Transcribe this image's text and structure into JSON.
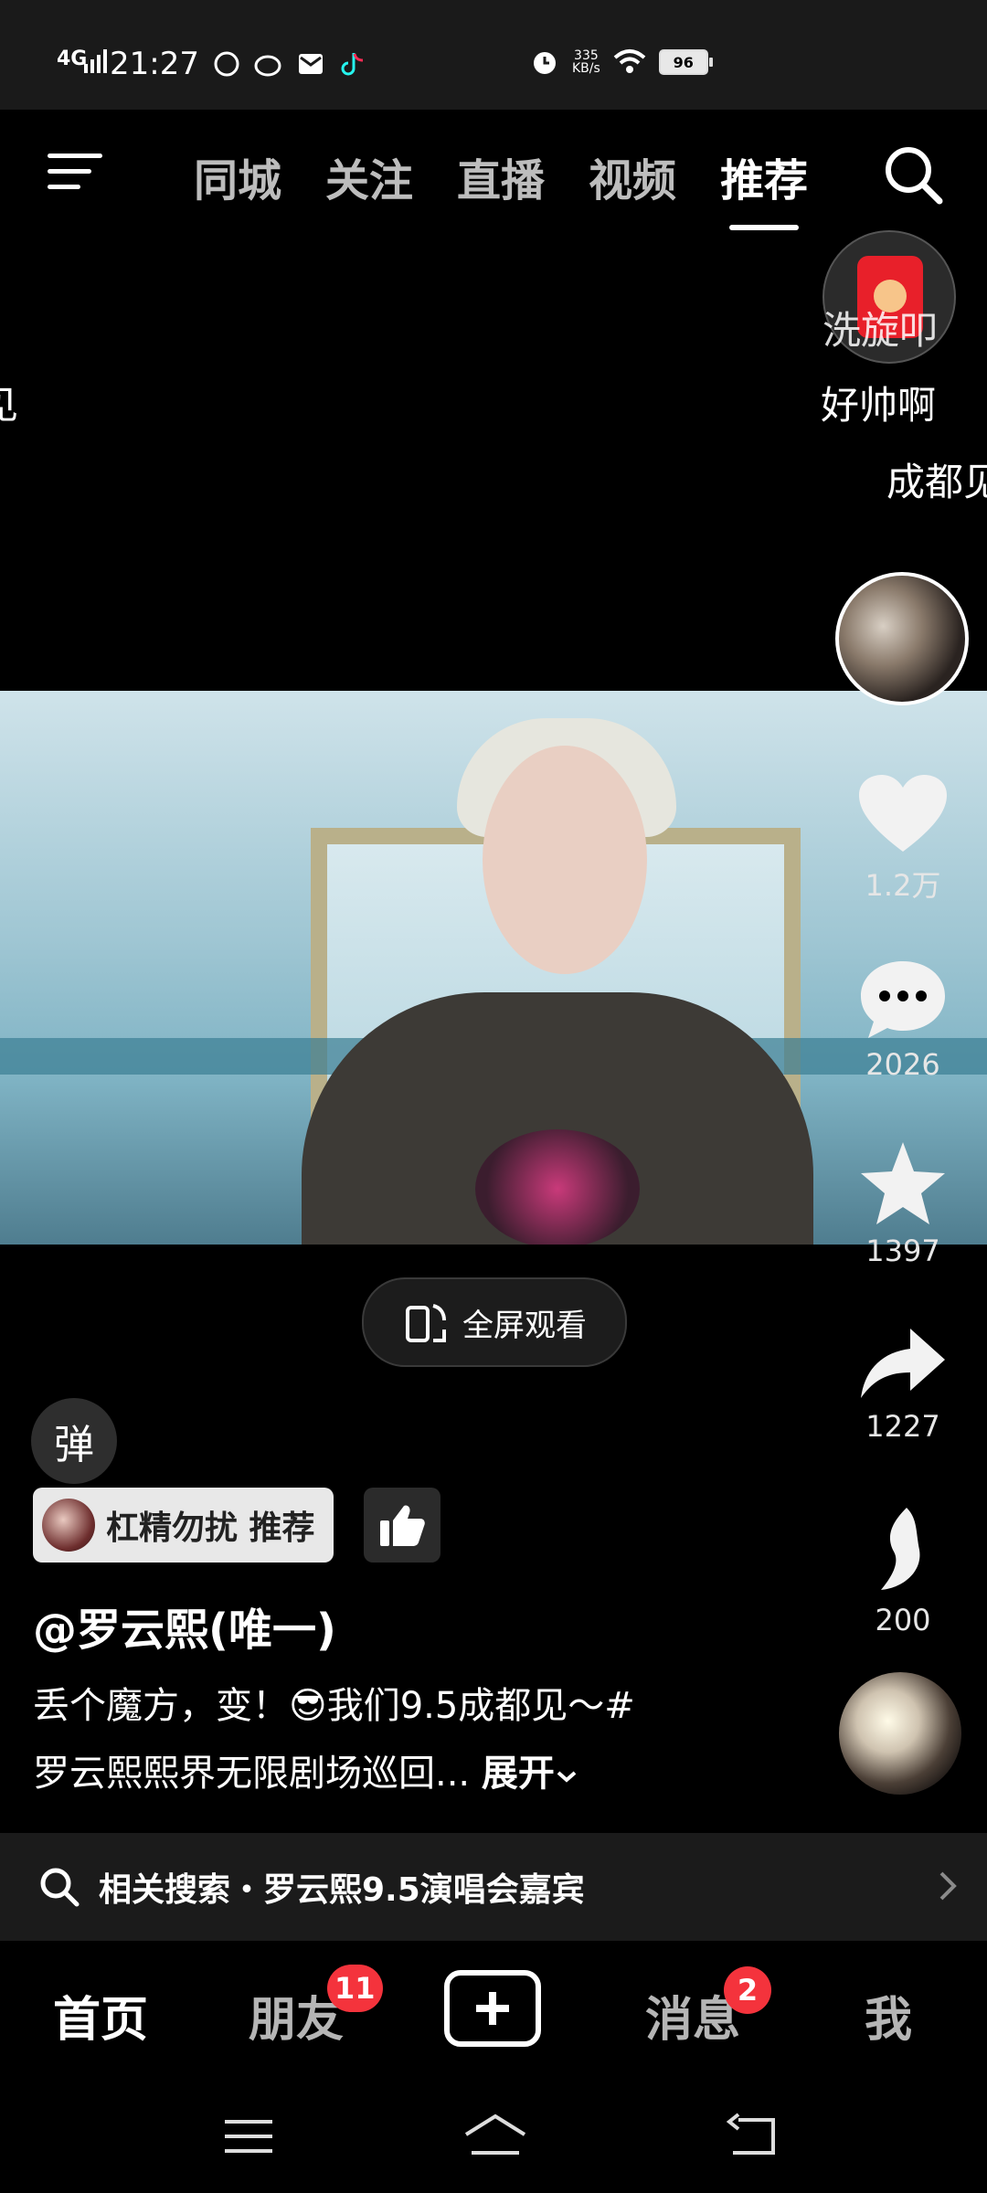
{
  "status_bar": {
    "network": "4G",
    "time": "21:27",
    "speed_value": "335",
    "speed_unit": "KB/s",
    "battery": "96"
  },
  "top_nav": {
    "tabs": [
      {
        "label": "同城"
      },
      {
        "label": "关注"
      },
      {
        "label": "直播"
      },
      {
        "label": "视频"
      },
      {
        "label": "推荐"
      }
    ],
    "active_tab": "推荐"
  },
  "danmaku": {
    "left_fragment": "见",
    "redpack_text": "洗旋叩",
    "line1": "好帅啊",
    "line2": "成都见"
  },
  "actions": {
    "like_count": "1.2万",
    "comment_count": "2026",
    "favorite_count": "1397",
    "share_count": "1227",
    "recommend_count": "200"
  },
  "fullscreen_label": "全屏观看",
  "danmu_toggle": "弹",
  "tag_chip": "杠精勿扰 推荐",
  "author": "@罗云熙(唯一)",
  "description": {
    "line1": "丢个魔方，变！😎我们9.5成都见～#",
    "line2": "罗云熙熙界无限剧场巡回...",
    "expand": "展开"
  },
  "related_search": {
    "text": "相关搜索・罗云熙9.5演唱会嘉宾"
  },
  "bottom_nav": {
    "home": "首页",
    "friends": "朋友",
    "friends_badge": "11",
    "messages": "消息",
    "messages_badge": "2",
    "me": "我"
  }
}
